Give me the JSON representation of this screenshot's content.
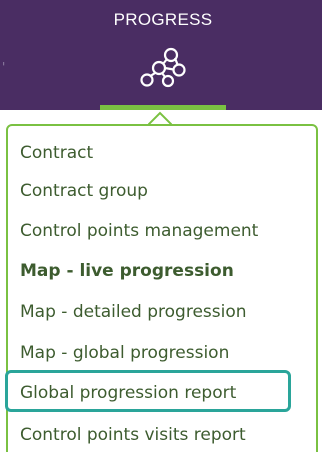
{
  "header": {
    "tab_label": "PROGRESS",
    "tab_icon": "progress-network-icon",
    "edge_mark": "'"
  },
  "menu": {
    "items": [
      {
        "label": "Contract",
        "bold": false
      },
      {
        "label": "Contract group",
        "bold": false
      },
      {
        "label": "Control points management",
        "bold": false
      },
      {
        "label": "Map - live progression",
        "bold": true
      },
      {
        "label": "Map - detailed progression",
        "bold": false
      },
      {
        "label": "Map - global progression",
        "bold": false
      },
      {
        "label": "Global progression report",
        "bold": false
      },
      {
        "label": "Control points visits report",
        "bold": false
      }
    ],
    "highlighted_item": "Global progression report"
  },
  "colors": {
    "topbar_bg": "#4a2d63",
    "accent_green": "#7ac142",
    "menu_text": "#3d5c2f",
    "highlight_border": "#2aa59a"
  }
}
